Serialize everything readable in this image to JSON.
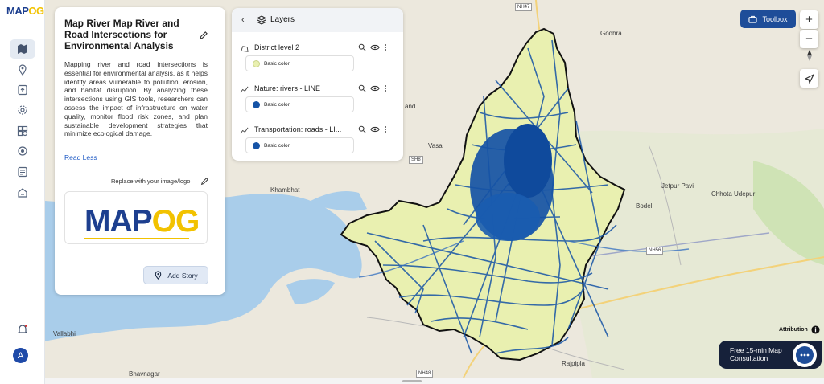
{
  "app": {
    "logo_main": "MAP",
    "logo_accent": "OG"
  },
  "sidebar": {
    "items": [
      {
        "name": "map-icon",
        "active": true
      },
      {
        "name": "location-pin-icon"
      },
      {
        "name": "upload-icon"
      },
      {
        "name": "settings-gear-icon"
      },
      {
        "name": "layers-grid-icon"
      },
      {
        "name": "target-icon"
      },
      {
        "name": "checklist-icon"
      },
      {
        "name": "share-icon"
      }
    ],
    "notification_icon": "bell-icon",
    "avatar_letter": "A"
  },
  "story": {
    "title": "Map River Map River and Road Intersections for Environmental Analysis",
    "body": "Mapping river and road intersections is essential for environmental analysis, as it helps identify areas vulnerable to pollution, erosion, and habitat disruption. By analyzing these intersections using GIS tools, researchers can assess the impact of infrastructure on water quality, monitor flood risk zones, and plan sustainable development strategies that minimize ecological damage.",
    "read_less": "Read Less",
    "replace_label": "Replace with your image/logo",
    "logo_main": "MAP",
    "logo_accent": "OG",
    "add_story_label": "Add Story"
  },
  "layers_panel": {
    "title": "Layers",
    "layers": [
      {
        "name": "District level 2",
        "style_label": "Basic color",
        "color": "#e9f0b0",
        "icon": "polygon-icon"
      },
      {
        "name": "Nature: rivers - LINE",
        "style_label": "Basic color",
        "color": "#1553a6",
        "icon": "line-icon"
      },
      {
        "name": "Transportation: roads - LI...",
        "style_label": "Basic color",
        "color": "#1553a6",
        "icon": "line-icon"
      }
    ]
  },
  "map": {
    "toolbox_label": "Toolbox",
    "zoom_in": "+",
    "zoom_out": "−",
    "attribution": "Attribution",
    "consult_line1": "Free 15-min Map",
    "consult_line2": "Consultation",
    "labels": [
      {
        "text": "Godhra"
      },
      {
        "text": "Vasa"
      },
      {
        "text": "Khambhat"
      },
      {
        "text": "Jetpur Pavi"
      },
      {
        "text": "Chhota Udepur"
      },
      {
        "text": "Bodeli"
      },
      {
        "text": "Vallabhi"
      },
      {
        "text": "Rajpipla"
      },
      {
        "text": "Bhavnagar"
      },
      {
        "text": "and"
      }
    ],
    "road_badges": [
      "NH47",
      "NH56",
      "NH48",
      "SH8"
    ],
    "colors": {
      "district_fill": "#e9f0b0",
      "network": "#1553a6",
      "water": "#a9cdea",
      "land": "#ece8dd"
    }
  }
}
